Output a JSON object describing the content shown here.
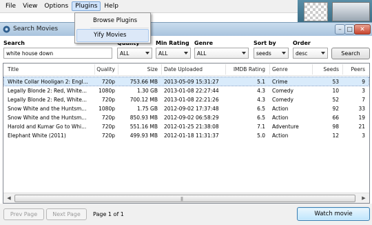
{
  "menubar": {
    "items": [
      "File",
      "View",
      "Options",
      "Plugins",
      "Help"
    ]
  },
  "plugins_menu": {
    "items": [
      "Browse Plugins",
      "Yify Movies"
    ]
  },
  "window": {
    "title": "Search Movies"
  },
  "search": {
    "label": "Search",
    "value": "white house down",
    "quality": {
      "label": "Quality",
      "value": "ALL"
    },
    "min_rating": {
      "label": "Min Rating",
      "value": "ALL"
    },
    "genre": {
      "label": "Genre",
      "value": "ALL"
    },
    "sort_by": {
      "label": "Sort by",
      "value": "seeds"
    },
    "order": {
      "label": "Order",
      "value": "desc"
    },
    "button": "Search"
  },
  "table": {
    "columns": [
      "Title",
      "Quality",
      "Size",
      "Date Uploaded",
      "IMDB Rating",
      "Genre",
      "Seeds",
      "Peers"
    ],
    "rows": [
      [
        "White Collar Hooligan 2: Engl...",
        "720p",
        "753.66 MB",
        "2013-05-09 15:31:27",
        "5.1",
        "Crime",
        "53",
        "9"
      ],
      [
        "Legally Blonde 2: Red, White...",
        "1080p",
        "1.30 GB",
        "2013-01-08 22:27:44",
        "4.3",
        "Comedy",
        "10",
        "3"
      ],
      [
        "Legally Blonde 2: Red, White...",
        "720p",
        "700.12 MB",
        "2013-01-08 22:21:26",
        "4.3",
        "Comedy",
        "52",
        "7"
      ],
      [
        "Snow White and the Huntsm...",
        "1080p",
        "1.75 GB",
        "2012-09-02 17:37:48",
        "6.5",
        "Action",
        "92",
        "33"
      ],
      [
        "Snow White and the Huntsm...",
        "720p",
        "850.93 MB",
        "2012-09-02 06:58:29",
        "6.5",
        "Action",
        "66",
        "19"
      ],
      [
        "Harold and Kumar Go to Whi...",
        "720p",
        "551.16 MB",
        "2012-01-25 21:38:08",
        "7.1",
        "Adventure",
        "98",
        "21"
      ],
      [
        "Elephant White (2011)",
        "720p",
        "499.93 MB",
        "2012-01-18 11:31:37",
        "5.0",
        "Action",
        "12",
        "3"
      ]
    ]
  },
  "footer": {
    "prev_label": "Prev Page",
    "next_label": "Next Page",
    "page_info": "Page 1 of 1",
    "watch_label": "Watch movie"
  },
  "colors": {
    "selection": "#d9ebfb",
    "accent": "#3c7fb1"
  }
}
